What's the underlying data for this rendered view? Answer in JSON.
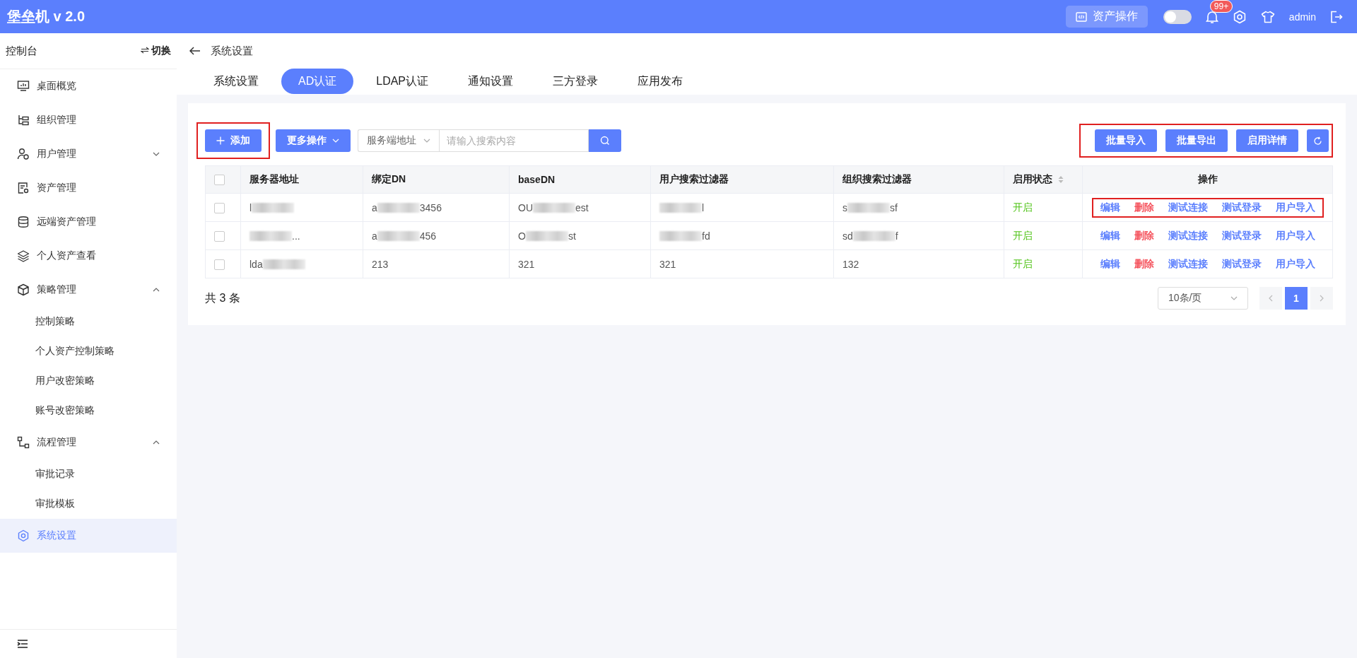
{
  "header": {
    "title": "堡垒机 v 2.0",
    "asset_button": "资产操作",
    "theme_switch": {
      "on": false
    },
    "notification_badge": "99+",
    "user": "admin"
  },
  "sidebar": {
    "title": "控制台",
    "switch_label": "切换",
    "items": [
      {
        "label": "桌面概览",
        "selected": false
      },
      {
        "label": "组织管理",
        "selected": false
      },
      {
        "label": "用户管理",
        "selected": false,
        "expanded": false
      },
      {
        "label": "资产管理",
        "selected": false
      },
      {
        "label": "远端资产管理",
        "selected": false
      },
      {
        "label": "个人资产查看",
        "selected": false
      },
      {
        "label": "策略管理",
        "selected": false,
        "expanded": true,
        "children": [
          {
            "label": "控制策略",
            "selected": false
          },
          {
            "label": "个人资产控制策略",
            "selected": false
          },
          {
            "label": "用户改密策略",
            "selected": false
          },
          {
            "label": "账号改密策略",
            "selected": false
          }
        ]
      },
      {
        "label": "流程管理",
        "selected": false,
        "expanded": true,
        "children": [
          {
            "label": "审批记录",
            "selected": false
          },
          {
            "label": "审批模板",
            "selected": false
          }
        ]
      },
      {
        "label": "系统设置",
        "selected": true
      }
    ]
  },
  "breadcrumb": "系统设置",
  "tabs": [
    {
      "label": "系统设置",
      "selected": false
    },
    {
      "label": "AD认证",
      "selected": true
    },
    {
      "label": "LDAP认证",
      "selected": false
    },
    {
      "label": "通知设置",
      "selected": false
    },
    {
      "label": "三方登录",
      "selected": false
    },
    {
      "label": "应用发布",
      "selected": false
    }
  ],
  "toolbar": {
    "add_button": "添加",
    "add_highlighted": true,
    "more_button": "更多操作",
    "search_scope": "服务端地址",
    "search": {
      "placeholder": "请输入搜索内容"
    },
    "right_buttons": [
      "批量导入",
      "批量导出",
      "启用详情"
    ],
    "right_highlighted": true
  },
  "table": {
    "all_checked": false,
    "columns": [
      "服务器地址",
      "绑定DN",
      "baseDN",
      "用户搜索过滤器",
      "组织搜索过滤器",
      "启用状态",
      "操作"
    ],
    "rows": [
      {
        "checked": false,
        "cells": [
          [
            {
              "kind": "text",
              "text": "l"
            },
            {
              "kind": "blur"
            }
          ],
          [
            {
              "kind": "text",
              "text": "a"
            },
            {
              "kind": "blur"
            },
            {
              "kind": "text",
              "text": "3456"
            }
          ],
          [
            {
              "kind": "text",
              "text": "OU"
            },
            {
              "kind": "blur"
            },
            {
              "kind": "text",
              "text": "est"
            }
          ],
          [
            {
              "kind": "blur"
            },
            {
              "kind": "text",
              "text": "l"
            }
          ],
          [
            {
              "kind": "text",
              "text": "s"
            },
            {
              "kind": "blur"
            },
            {
              "kind": "text",
              "text": "sf"
            }
          ]
        ],
        "status": "开启",
        "actions": [
          "编辑",
          "删除",
          "测试连接",
          "测试登录",
          "用户导入"
        ],
        "actions_highlighted": true
      },
      {
        "checked": false,
        "cells": [
          [
            {
              "kind": "blur"
            },
            {
              "kind": "text",
              "text": "..."
            }
          ],
          [
            {
              "kind": "text",
              "text": "a"
            },
            {
              "kind": "blur"
            },
            {
              "kind": "text",
              "text": "456"
            }
          ],
          [
            {
              "kind": "text",
              "text": "O"
            },
            {
              "kind": "blur"
            },
            {
              "kind": "text",
              "text": "st"
            }
          ],
          [
            {
              "kind": "blur"
            },
            {
              "kind": "text",
              "text": "fd"
            }
          ],
          [
            {
              "kind": "text",
              "text": "sd"
            },
            {
              "kind": "blur"
            },
            {
              "kind": "text",
              "text": "f"
            }
          ]
        ],
        "status": "开启",
        "actions": [
          "编辑",
          "删除",
          "测试连接",
          "测试登录",
          "用户导入"
        ],
        "actions_highlighted": false
      },
      {
        "checked": false,
        "cells": [
          [
            {
              "kind": "text",
              "text": "lda"
            },
            {
              "kind": "blur"
            }
          ],
          [
            {
              "kind": "text",
              "text": "213"
            }
          ],
          [
            {
              "kind": "text",
              "text": "321"
            }
          ],
          [
            {
              "kind": "text",
              "text": "321"
            }
          ],
          [
            {
              "kind": "text",
              "text": "132"
            }
          ]
        ],
        "status": "开启",
        "actions": [
          "编辑",
          "删除",
          "测试连接",
          "测试登录",
          "用户导入"
        ],
        "actions_highlighted": false
      }
    ]
  },
  "footer": {
    "total": "共 3 条",
    "page_size": "10条/页",
    "pages": [
      {
        "label": "1",
        "selected": true
      }
    ]
  }
}
